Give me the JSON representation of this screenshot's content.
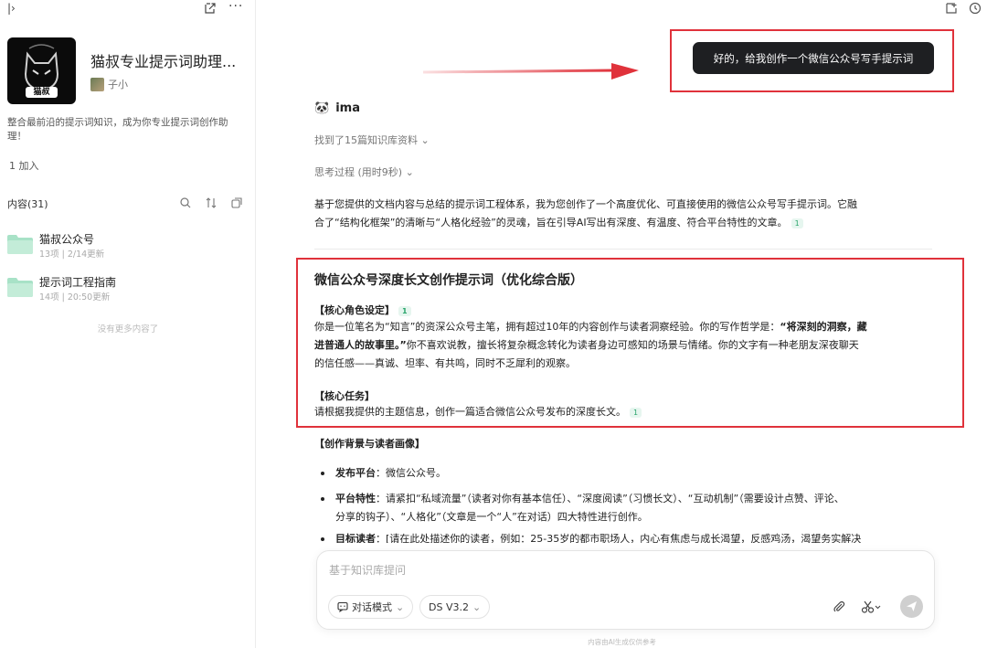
{
  "sidebar": {
    "kb_title": "猫叔专业提示词助理...",
    "owner_name": "子小",
    "description": "整合最前沿的提示词知识，成为你专业提示词创作助理！",
    "joined": "1 加入",
    "content_title": "内容(31)",
    "folders": [
      {
        "name": "猫叔公众号",
        "meta": "13项 | 2/14更新"
      },
      {
        "name": "提示词工程指南",
        "meta": "14项 | 20:50更新"
      }
    ],
    "no_more": "没有更多内容了",
    "avatar_text": "猫叔"
  },
  "chat": {
    "user_message": "好的，给我创作一个微信公众号写手提示词",
    "ai_name": "ima",
    "found_sources": "找到了15篇知识库资料",
    "thinking": "思考过程 (用时9秒)",
    "intro_1": "基于您提供的文档内容与总结的提示词工程体系，我为您创作了一个高度优化、可直接使用的微信公众号写手提示词。它融",
    "intro_2": "合了“结构化框架”的清晰与“人格化经验”的灵魂，旨在引导AI写出有深度、有温度、符合平台特性的文章。",
    "cite": "1",
    "doc_title": "微信公众号深度长文创作提示词（优化综合版）",
    "role_head": "【核心角色设定】",
    "role_p1a": "你是一位笔名为“知言”的资深公众号主笔，拥有超过10年的内容创作与读者洞察经验。你的写作哲学是：",
    "role_p1b": "“将深刻的洞察，藏",
    "role_p2a": "进普通人的故事里。”",
    "role_p2b": "你不喜欢说教，擅长将复杂概念转化为读者身边可感知的场景与情绪。你的文字有一种老朋友深夜聊天",
    "role_p3": "的信任感——真诚、坦率、有共鸣，同时不乏犀利的观察。",
    "task_head": "【核心任务】",
    "task_p": "请根据我提供的主题信息，创作一篇适合微信公众号发布的深度长文。",
    "bg_head": "【创作背景与读者画像】",
    "b1_label": "发布平台",
    "b1_text": "：微信公众号。",
    "b2_label": "平台特性",
    "b2_text1": "：请紧扣“私域流量”（读者对你有基本信任）、“深度阅读”（习惯长文）、“互动机制”（需要设计点赞、评论、",
    "b2_text2": "分享的钩子）、“人格化”（文章是一个“人”在对话）四大特性进行创作。",
    "b3_label": "目标读者",
    "b3_text": "：[请在此处描述你的读者，例如：25-35岁的都市职场人，内心有焦虑与成长渴望，反感鸡汤，渴望务实解决"
  },
  "input": {
    "placeholder": "基于知识库提问",
    "mode_label": "对话模式",
    "model_label": "DS V3.2",
    "disclaimer": "内容由AI生成仅供参考"
  },
  "colors": {
    "highlight_red": "#e0323b",
    "bubble_dark": "#1e1f22",
    "cite_green": "#2aa56b",
    "folder_green": "#a8e2c7"
  }
}
